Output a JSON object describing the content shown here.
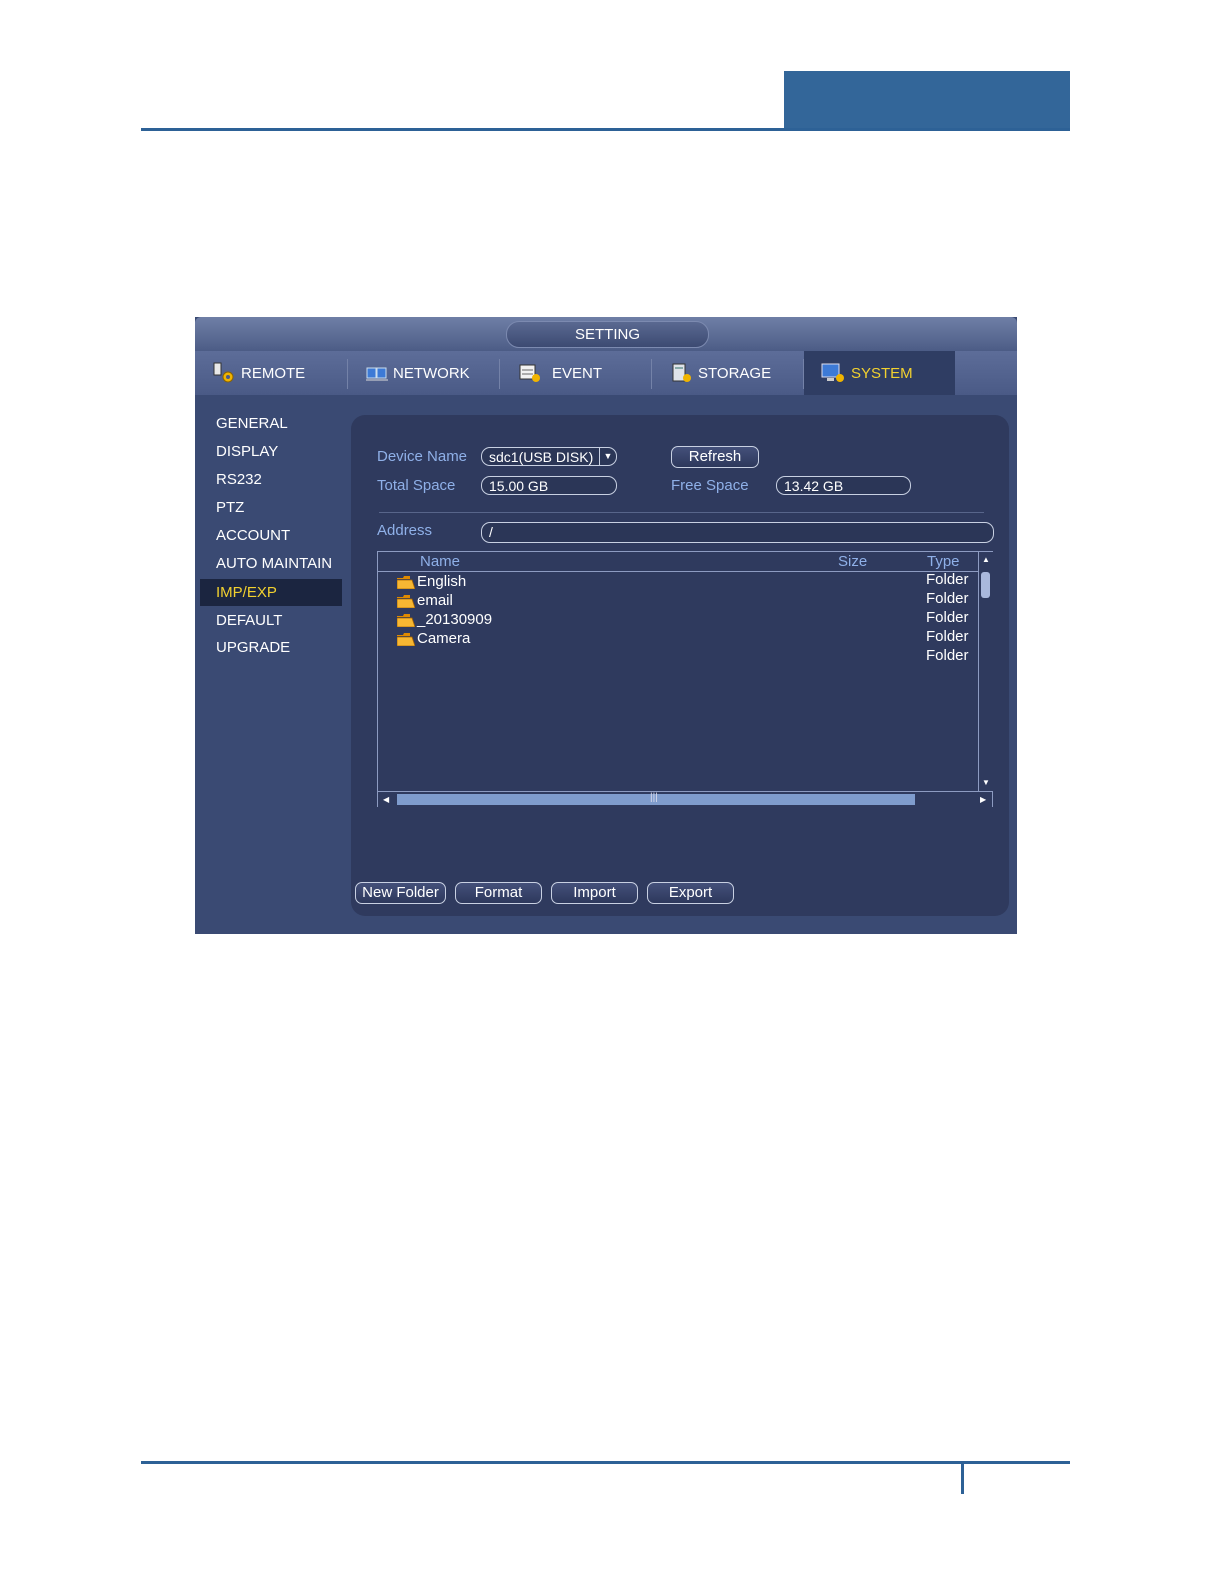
{
  "window": {
    "title": "SETTING"
  },
  "tabs": [
    {
      "label": "REMOTE",
      "icon": "remote-gear-icon"
    },
    {
      "label": "NETWORK",
      "icon": "network-icon"
    },
    {
      "label": "EVENT",
      "icon": "event-icon"
    },
    {
      "label": "STORAGE",
      "icon": "storage-icon"
    },
    {
      "label": "SYSTEM",
      "icon": "system-monitor-icon",
      "active": true
    }
  ],
  "sidebar": {
    "items": [
      {
        "label": "GENERAL"
      },
      {
        "label": "DISPLAY"
      },
      {
        "label": "RS232"
      },
      {
        "label": "PTZ"
      },
      {
        "label": "ACCOUNT"
      },
      {
        "label": "AUTO MAINTAIN"
      },
      {
        "label": "IMP/EXP",
        "active": true
      },
      {
        "label": "DEFAULT"
      },
      {
        "label": "UPGRADE"
      }
    ]
  },
  "form": {
    "device_name_label": "Device Name",
    "device_name_value": "sdc1(USB DISK)",
    "refresh_label": "Refresh",
    "total_space_label": "Total Space",
    "total_space_value": "15.00 GB",
    "free_space_label": "Free Space",
    "free_space_value": "13.42 GB",
    "address_label": "Address",
    "address_value": "/"
  },
  "file_list": {
    "columns": {
      "name": "Name",
      "size": "Size",
      "type": "Type"
    },
    "rows": [
      {
        "name": "English",
        "type": "Folder"
      },
      {
        "name": "email",
        "type": "Folder"
      },
      {
        "name": "_20130909",
        "type": "Folder"
      },
      {
        "name": "Camera",
        "type": "Folder"
      },
      {
        "name": "",
        "type": "Folder"
      }
    ],
    "hscroll_grip": "|||"
  },
  "buttons": {
    "new_folder": "New Folder",
    "format": "Format",
    "import": "Import",
    "export": "Export"
  },
  "colors": {
    "accent_yellow": "#f2d12f",
    "label_blue": "#8fb0e8",
    "page_rule": "#2d6196"
  }
}
